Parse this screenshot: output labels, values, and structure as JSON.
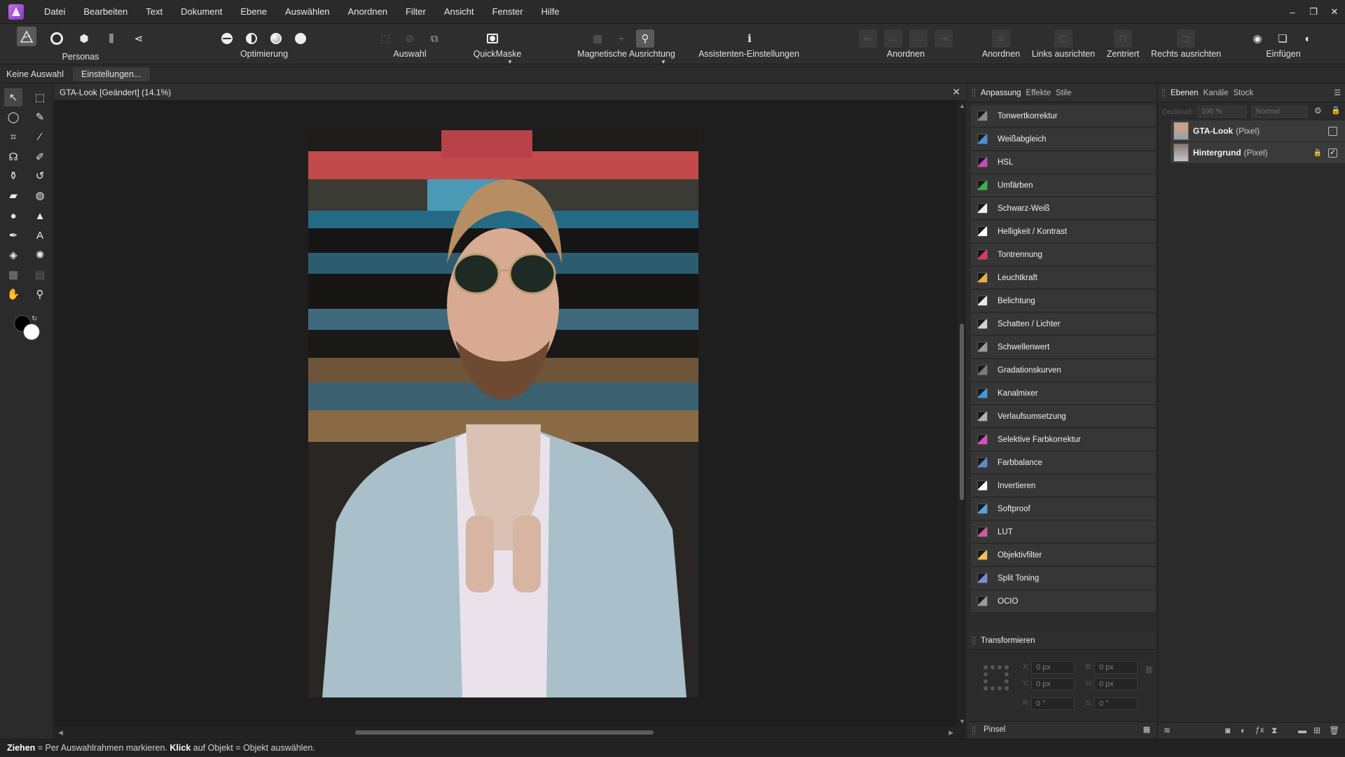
{
  "menu": {
    "items": [
      "Datei",
      "Bearbeiten",
      "Text",
      "Dokument",
      "Ebene",
      "Auswählen",
      "Anordnen",
      "Filter",
      "Ansicht",
      "Fenster",
      "Hilfe"
    ]
  },
  "window_controls": {
    "minimize": "–",
    "restore": "❐",
    "close": "✕"
  },
  "toolbar": {
    "personas_label": "Personas",
    "optimierung_label": "Optimierung",
    "auswahl_label": "Auswahl",
    "quickmaske_label": "QuickMaske",
    "magnet_label": "Magnetische Ausrichtung",
    "assistent_label": "Assistenten-Einstellungen",
    "anordnen1_label": "Anordnen",
    "anordnen2_label": "Anordnen",
    "links_label": "Links ausrichten",
    "zentriert_label": "Zentriert",
    "rechts_label": "Rechts ausrichten",
    "einfuegen_label": "Einfügen"
  },
  "context": {
    "no_selection": "Keine Auswahl",
    "settings_button": "Einstellungen..."
  },
  "document": {
    "title": "GTA-Look [Geändert] (14.1%)",
    "close": "✕"
  },
  "adjust_panel": {
    "tabs": [
      "Anpassung",
      "Effekte",
      "Stile"
    ],
    "items": [
      {
        "label": "Tonwertkorrektur",
        "color": "#8a8a8a"
      },
      {
        "label": "Weißabgleich",
        "color": "#4a8fd6"
      },
      {
        "label": "HSL",
        "color": "#c84ab8"
      },
      {
        "label": "Umfärben",
        "color": "#3fb04a"
      },
      {
        "label": "Schwarz-Weiß",
        "color": "#f0f0f0"
      },
      {
        "label": "Helligkeit / Kontrast",
        "color": "#ffffff"
      },
      {
        "label": "Tontrennung",
        "color": "#e03a5a"
      },
      {
        "label": "Leuchtkraft",
        "color": "#e9b03a"
      },
      {
        "label": "Belichtung",
        "color": "#e8e8e8"
      },
      {
        "label": "Schatten / Lichter",
        "color": "#d0d0d0"
      },
      {
        "label": "Schwellenwert",
        "color": "#9a9a9a"
      },
      {
        "label": "Gradationskurven",
        "color": "#7a7a7a"
      },
      {
        "label": "Kanalmixer",
        "color": "#3a9ae0"
      },
      {
        "label": "Verlaufsumsetzung",
        "color": "#b0b0b0"
      },
      {
        "label": "Selektive Farbkorrektur",
        "color": "#e04ac0"
      },
      {
        "label": "Farbbalance",
        "color": "#5a8ad0"
      },
      {
        "label": "Invertieren",
        "color": "#ffffff"
      },
      {
        "label": "Softproof",
        "color": "#5aa0e0"
      },
      {
        "label": "LUT",
        "color": "#d05aa0"
      },
      {
        "label": "Objektivfilter",
        "color": "#f0c050"
      },
      {
        "label": "Split Toning",
        "color": "#7a8ad8"
      },
      {
        "label": "OCIO",
        "color": "#9a9a9a"
      }
    ]
  },
  "transform_panel": {
    "title": "Transformieren",
    "x": "0 px",
    "y": "0 px",
    "b": "0 px",
    "h": "0 px",
    "r": "0 °",
    "s": "0 °",
    "lbl_x": "X:",
    "lbl_y": "Y:",
    "lbl_b": "B:",
    "lbl_h": "H:",
    "lbl_r": "R:",
    "lbl_s": "S:"
  },
  "brush_bar": {
    "label": "Pinsel"
  },
  "layers_panel": {
    "tabs": [
      "Ebenen",
      "Kanäle",
      "Stock"
    ],
    "opacity_label": "Deckkraft:",
    "opacity": "100 %",
    "blend_mode": "Normal",
    "layers": [
      {
        "name": "GTA-Look",
        "type": "(Pixel)",
        "checked": false
      },
      {
        "name": "Hintergrund",
        "type": "(Pixel)",
        "checked": true
      }
    ]
  },
  "status": {
    "b1": "Ziehen",
    "t1": " = Per Auswahlrahmen markieren. ",
    "b2": "Klick",
    "t2": " auf Objekt = Objekt auswählen."
  },
  "colors": {
    "accent": "#9b59d0",
    "panel": "#2b2b2b",
    "canvas": "#1e1e1e"
  }
}
